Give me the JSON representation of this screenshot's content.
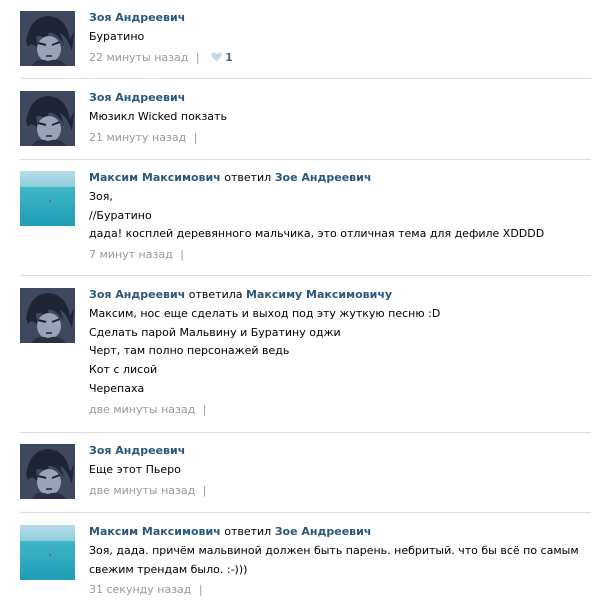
{
  "comments": [
    {
      "author": "Зоя Андреевич",
      "avatar": "anime-boy-avatar",
      "lines": [
        "Буратино"
      ],
      "time": "22 минуты назад",
      "separator": "|",
      "likes": "1"
    },
    {
      "author": "Зоя Андреевич",
      "avatar": "anime-boy-avatar",
      "lines": [
        "Мюзикл Wicked покзать"
      ],
      "time": "21 минуту назад",
      "separator": "|"
    },
    {
      "author": "Максим Максимович",
      "reply_verb": "ответил",
      "reply_to": "Зое Андреевич",
      "avatar": "sea-avatar",
      "lines": [
        "Зоя,",
        "//Буратино",
        "дада! косплей деревянного мальчика, это отличная тема для дефиле XDDDD"
      ],
      "time": "7 минут назад",
      "separator": "|"
    },
    {
      "author": "Зоя Андреевич",
      "reply_verb": "ответила",
      "reply_to": "Максиму Максимовичу",
      "avatar": "anime-boy-avatar",
      "lines": [
        "Максим, нос еще сделать и выход под эту жуткую песню :D",
        "Сделать парой Мальвину и Буратину оджи",
        "Черт, там полно персонажей ведь",
        "Кот с лисой",
        "Черепаха"
      ],
      "time": "две минуты назад",
      "separator": "|"
    },
    {
      "author": "Зоя Андреевич",
      "avatar": "anime-boy-avatar",
      "lines": [
        "Еще этот Пьеро"
      ],
      "time": "две минуты назад",
      "separator": "|"
    },
    {
      "author": "Максим Максимович",
      "reply_verb": "ответил",
      "reply_to": "Зое Андреевич",
      "avatar": "sea-avatar",
      "lines": [
        "Зоя, дада. причём мальвиной должен быть парень. небритый. что бы всё по самым",
        "свежим трендам было. :-)))"
      ],
      "time": "31 секунду назад",
      "separator": "|"
    }
  ],
  "colors": {
    "link": "#2b587a",
    "meta": "#999999",
    "like": "#45688e",
    "divider": "#dcdcdc"
  }
}
